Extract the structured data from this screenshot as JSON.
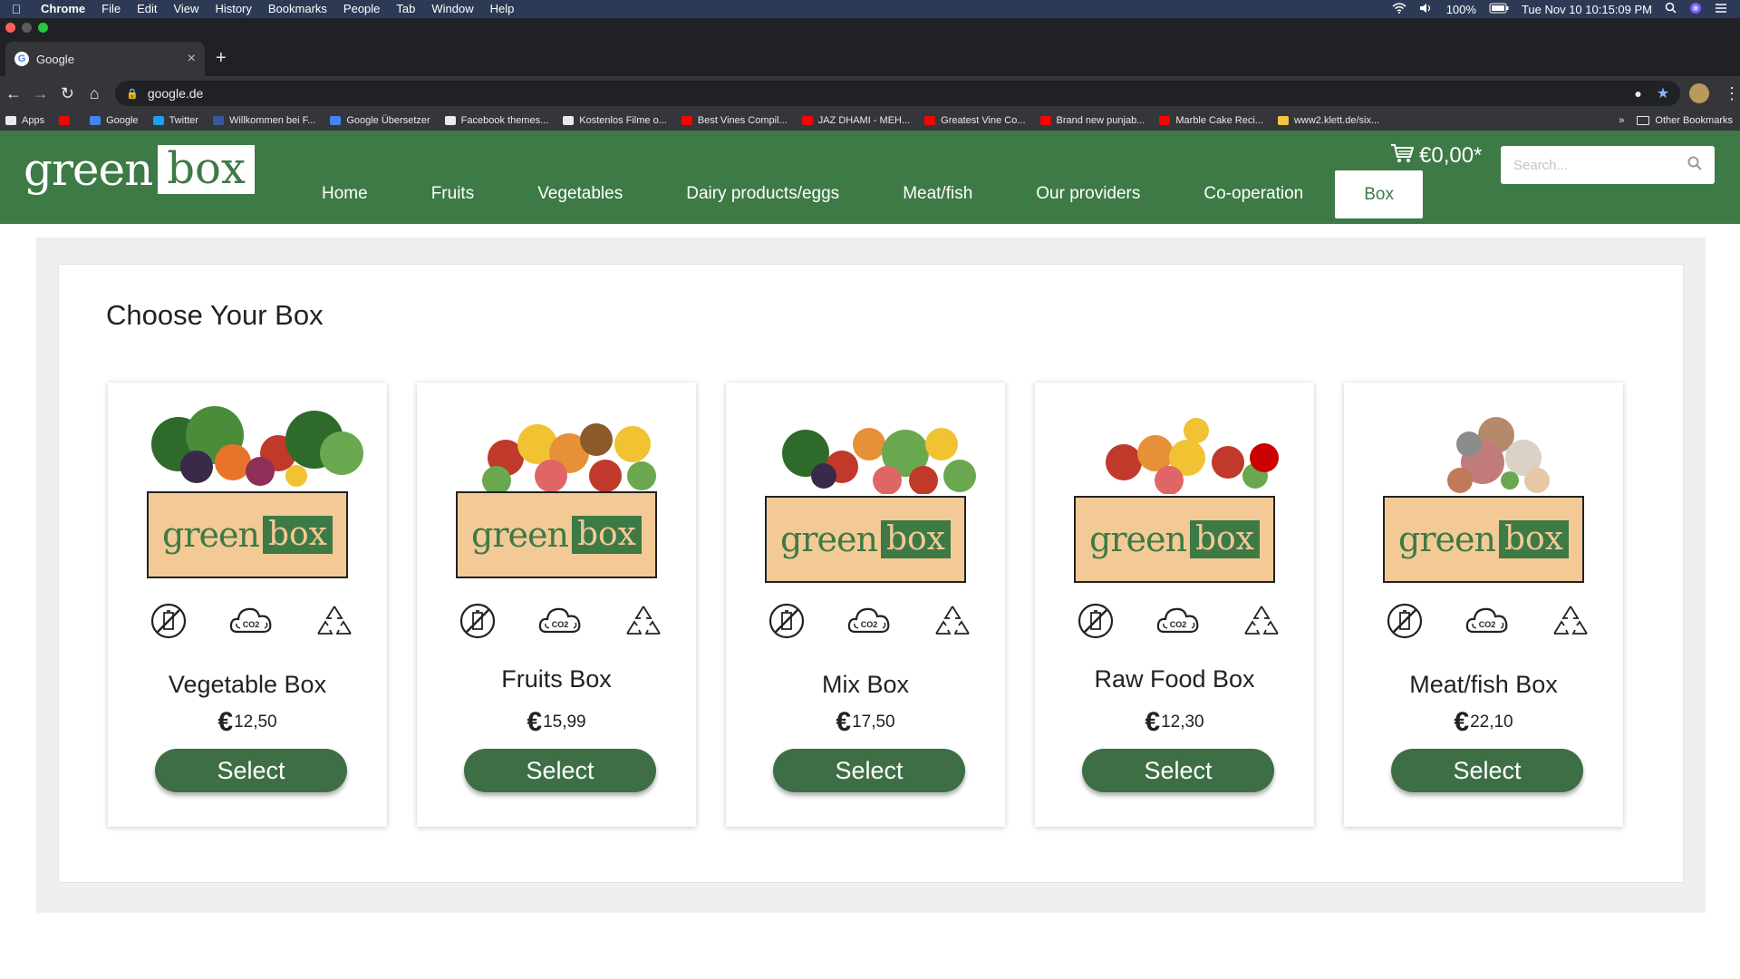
{
  "os_menubar": {
    "app": "Chrome",
    "items": [
      "File",
      "Edit",
      "View",
      "History",
      "Bookmarks",
      "People",
      "Tab",
      "Window",
      "Help"
    ],
    "battery": "100%",
    "clock": "Tue Nov 10  10:15:09 PM"
  },
  "browser": {
    "tab_title": "Google",
    "url": "google.de",
    "bookmarks": [
      {
        "label": "Apps",
        "color": "#e8eaed"
      },
      {
        "label": "",
        "color": "#ff0000"
      },
      {
        "label": "Google",
        "color": "#4285f4"
      },
      {
        "label": "Twitter",
        "color": "#1da1f2"
      },
      {
        "label": "Willkommen bei F...",
        "color": "#3b5998"
      },
      {
        "label": "Google Übersetzer",
        "color": "#4285f4"
      },
      {
        "label": "Facebook themes...",
        "color": "#e8eaed"
      },
      {
        "label": "Kostenlos Filme o...",
        "color": "#e8eaed"
      },
      {
        "label": "Best Vines Compil...",
        "color": "#ff0000"
      },
      {
        "label": "JAZ DHAMI - MEH...",
        "color": "#ff0000"
      },
      {
        "label": "Greatest Vine Co...",
        "color": "#ff0000"
      },
      {
        "label": "Brand new punjab...",
        "color": "#ff0000"
      },
      {
        "label": "Marble Cake Reci...",
        "color": "#ff0000"
      },
      {
        "label": "www2.klett.de/six...",
        "color": "#f4c542"
      }
    ],
    "other_bookmarks": "Other Bookmarks",
    "more": "»"
  },
  "site": {
    "logo_green": "green",
    "logo_box": "box",
    "nav": [
      "Home",
      "Fruits",
      "Vegetables",
      "Dairy products/eggs",
      "Meat/fish",
      "Our providers",
      "Co-operation",
      "Box"
    ],
    "active_nav": "Box",
    "cart_total": "€0,00*",
    "search_placeholder": "Search..."
  },
  "main": {
    "title": "Choose Your Box",
    "currency_symbol": "€",
    "select_label": "Select",
    "co2_label": "CO2",
    "boxes": [
      {
        "name": "Vegetable Box",
        "price": "12,50",
        "produce": "vegetables"
      },
      {
        "name": "Fruits Box",
        "price": "15,99",
        "produce": "fruits"
      },
      {
        "name": "Mix Box",
        "price": "17,50",
        "produce": "mix"
      },
      {
        "name": "Raw Food Box",
        "price": "12,30",
        "produce": "raw"
      },
      {
        "name": "Meat/fish Box",
        "price": "22,10",
        "produce": "meat"
      }
    ],
    "icons": [
      "no-plastic-icon",
      "co2-cloud-icon",
      "recycle-icon"
    ]
  },
  "colors": {
    "brand_green": "#3d7a45",
    "crate": "#f3c996",
    "button": "#3d6e45"
  }
}
